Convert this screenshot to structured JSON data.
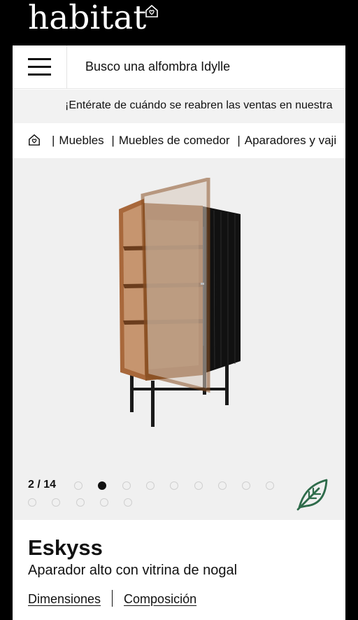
{
  "brand": {
    "name": "habitat"
  },
  "header": {
    "search_text": "Busco una alfombra Idylle"
  },
  "announcement": {
    "text": "¡Entérate de cuándo se reabren las ventas en nuestra"
  },
  "breadcrumb": {
    "items": [
      "Muebles",
      "Muebles de comedor",
      "Aparadores y vaji"
    ]
  },
  "gallery": {
    "current": 2,
    "total": 14,
    "counter_text": "2 / 14",
    "dot_count": 14,
    "active_dot_index": 1
  },
  "product": {
    "name": "Eskyss",
    "description": "Aparador alto con vitrina de nogal",
    "links": {
      "dimensions": "Dimensiones",
      "composition": "Composición"
    },
    "eco_icon": "leaf-icon"
  },
  "colors": {
    "top_bar": "#000000",
    "gallery_bg": "#f0f0f0",
    "accent_green": "#2e6b4a"
  }
}
